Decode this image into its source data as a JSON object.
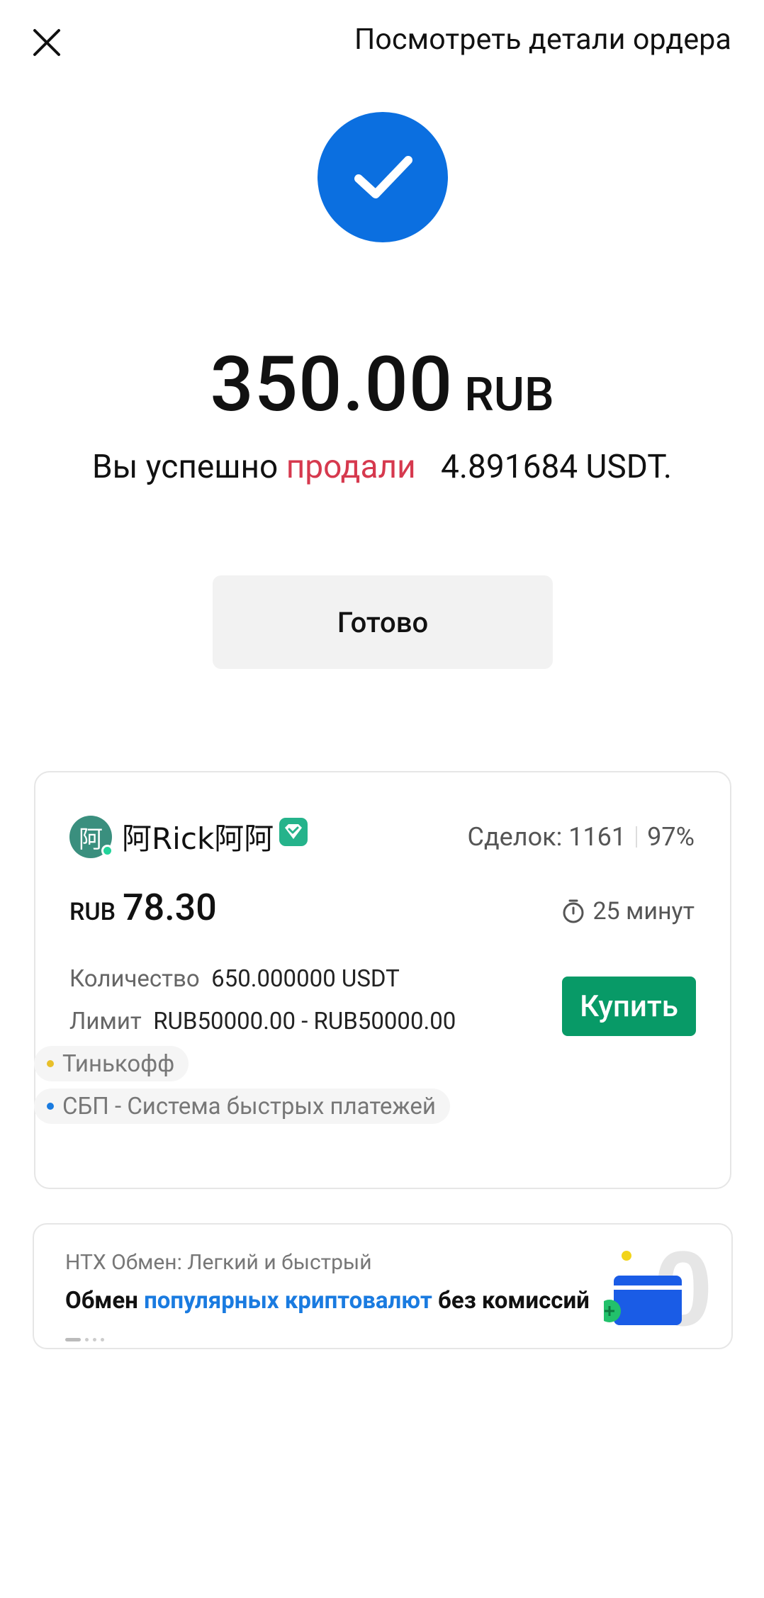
{
  "header": {
    "details_link": "Посмотреть детали ордера"
  },
  "result": {
    "amount": "350.00",
    "currency": "RUB",
    "text_prefix": "Вы успешно",
    "text_action": "продали",
    "text_amount": "4.891684 USDT."
  },
  "done_button": "Готово",
  "ad": {
    "avatar_char": "阿",
    "merchant": "阿Rick阿阿",
    "deals_label": "Сделок: 1161",
    "completion_rate": "97%",
    "price_currency": "RUB",
    "price": "78.30",
    "time_limit": "25 минут",
    "quantity_label": "Количество",
    "quantity_value": "650.000000  USDT",
    "limit_label": "Лимит",
    "limit_value": "RUB50000.00 - RUB50000.00",
    "buy_button": "Купить",
    "payment_methods": [
      {
        "name": "Тинькофф",
        "color": "#e8c02a"
      },
      {
        "name": "СБП - Система быстрых платежей",
        "color": "#1a7be0"
      }
    ]
  },
  "promo": {
    "subtitle": "HTX Обмен: Легкий и быстрый",
    "title_part1": "Обмен ",
    "title_highlight": "популярных криптовалют",
    "title_part2": " без комиссий"
  },
  "colors": {
    "primary_blue": "#0b6fe0",
    "sell_red": "#d6394e",
    "buy_green": "#089a67"
  }
}
